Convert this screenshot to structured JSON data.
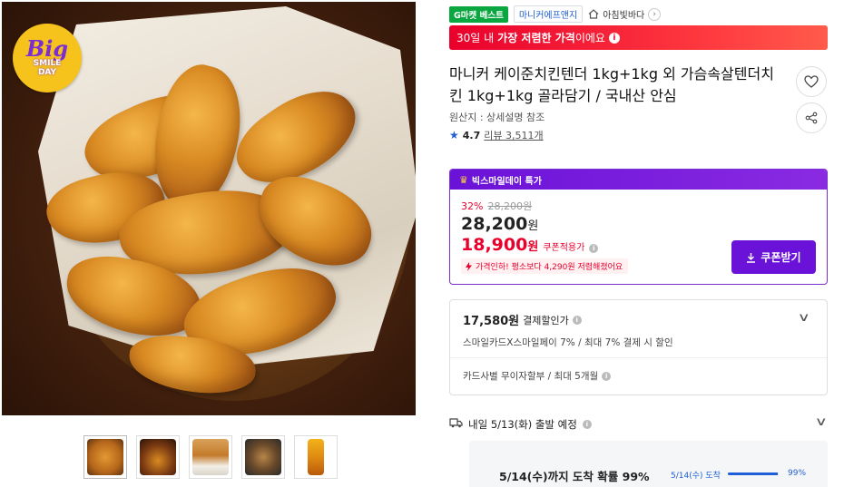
{
  "product_image": {
    "badge_line1": "Big",
    "badge_line2": "SMILE",
    "badge_line3": "DAY",
    "thumbnails_count": 5
  },
  "header": {
    "best_tag": "G마켓 베스트",
    "seller": "마니커에프앤지",
    "shop_name": "아침빛바다",
    "promo_prefix": "30일 내 ",
    "promo_bold": "가장 저렴한 가격",
    "promo_suffix": "이에요"
  },
  "product": {
    "title": "마니커 케이준치킨텐더 1kg+1kg 외 가슴속살텐더치킨 1kg+1kg 골라담기 / 국내산 안심",
    "origin": "원산지 : 상세설명 참조",
    "rating": "4.7",
    "review_text": "리뷰 3,511개"
  },
  "deal": {
    "header": "빅스마일데이 특가",
    "discount_pct": "32%",
    "original_price": "28,200원",
    "sale_price": "28,200",
    "won": "원",
    "coupon_price": "18,900",
    "coupon_label": "쿠폰적용가",
    "lowest_note": "가격인하! 평소보다 4,290원 저렴해졌어요",
    "coupon_button": "쿠폰받기"
  },
  "payment": {
    "amount": "17,580원",
    "amount_label": "결제할인가",
    "card_note": "스마일카드X스마일페이 7% / 최대 7% 결제 시 할인",
    "installment": "카드사별 무이자할부 / 최대 5개월"
  },
  "shipping": {
    "departure": "내일 5/13(화) 출발 예정",
    "arrival": "5/14(수)까지 도착 확률 99%",
    "arrival_mini": "5/14(수) 도착",
    "arrival_pct": "99%",
    "arrival_fraction": 0.99
  },
  "colors": {
    "accent_purple": "#6a12d8",
    "sale_red": "#e9002c",
    "best_green": "#0aa640",
    "link_blue": "#1f5fd6"
  }
}
